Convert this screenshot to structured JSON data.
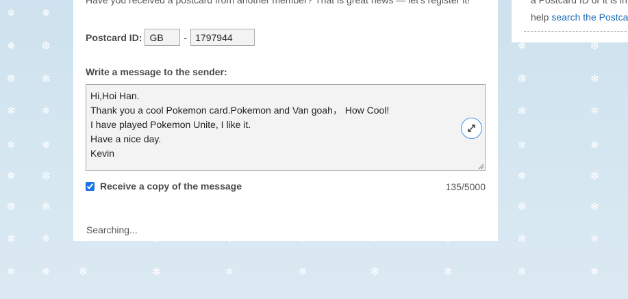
{
  "form": {
    "intro_text": "Have you received a postcard from another member? That is great news — let's register it!",
    "postcard_id_label": "Postcard ID:",
    "country_code": "GB",
    "separator": "-",
    "postcard_number": "1797944",
    "message_label": "Write a message to the sender:",
    "message_lines": [
      "Hi,Hoi Han.",
      "Thank you a cool Pokemon card.Pokemon and Van goah， How Cool!",
      "I have played Pokemon Unite, I like it.",
      "Have a nice day.",
      "Kevin"
    ],
    "copy_checkbox_checked": true,
    "copy_label": "Receive a copy of the message",
    "char_count": "135/5000",
    "status_text": "Searching..."
  },
  "sidebar": {
    "line1": "a Postcard ID or it is in",
    "line2_prefix": "help ",
    "line2_link": "search the Postcard"
  },
  "icons": {
    "expand": "expand-arrows-icon",
    "resize": "resize-grip-icon",
    "snowflake": "snowflake-icon"
  },
  "colors": {
    "background": "#cfe3ef",
    "link": "#1e6bb8",
    "accent": "#4a90e2",
    "text": "#555555",
    "input_bg": "#f3f3f3"
  }
}
